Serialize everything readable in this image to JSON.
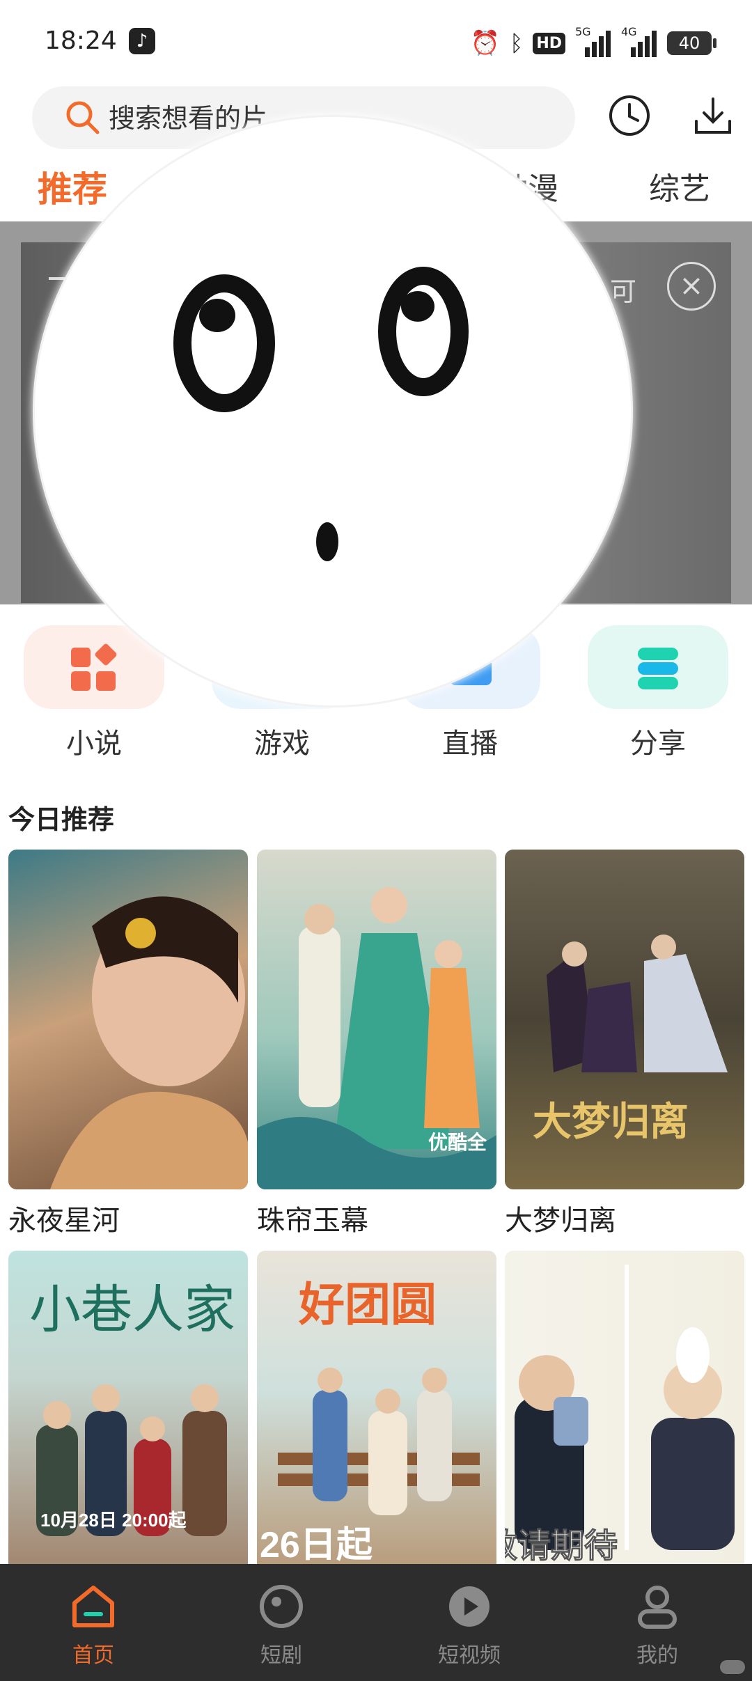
{
  "status_bar": {
    "time": "18:24",
    "hd": "HD",
    "network_5g": "5G",
    "network_4g": "4G",
    "battery": "40"
  },
  "search": {
    "placeholder": "搜索想看的片"
  },
  "tabs": [
    {
      "label": "推荐",
      "active": true
    },
    {
      "label": "动漫",
      "active": false
    },
    {
      "label": "综艺",
      "active": false
    }
  ],
  "banner": {
    "visible_text": "可",
    "close_glyph": "×"
  },
  "quick_entries": [
    {
      "label": "小说",
      "icon": "grid-apps-icon",
      "color": "#f26b4a"
    },
    {
      "label": "游戏",
      "icon": "gamepad-icon",
      "color": "#3fb4f2"
    },
    {
      "label": "直播",
      "icon": "live-play-icon",
      "color": "#3f9cf2"
    },
    {
      "label": "分享",
      "icon": "share-icon",
      "color": "#1fd3b0"
    }
  ],
  "section": {
    "title": "今日推荐"
  },
  "recommendations": [
    {
      "title": "永夜星河"
    },
    {
      "title": "珠帘玉幕",
      "poster_text": "优酷全网独播平台"
    },
    {
      "title": "大梦归离",
      "poster_text": "大梦归离"
    },
    {
      "title": "",
      "poster_text": "10月28日 20:00起"
    },
    {
      "title": "",
      "poster_text": "26日起"
    },
    {
      "title": "",
      "poster_text": "敬请期待"
    }
  ],
  "bottom_nav": [
    {
      "label": "首页",
      "icon": "home-icon",
      "active": true
    },
    {
      "label": "短剧",
      "icon": "short-drama-icon",
      "active": false
    },
    {
      "label": "短视频",
      "icon": "short-video-icon",
      "active": false
    },
    {
      "label": "我的",
      "icon": "profile-icon",
      "active": false
    }
  ],
  "colors": {
    "accent": "#f26b2a",
    "nav_bg": "#2d2d2d",
    "search_bg": "#f3f3f3"
  }
}
